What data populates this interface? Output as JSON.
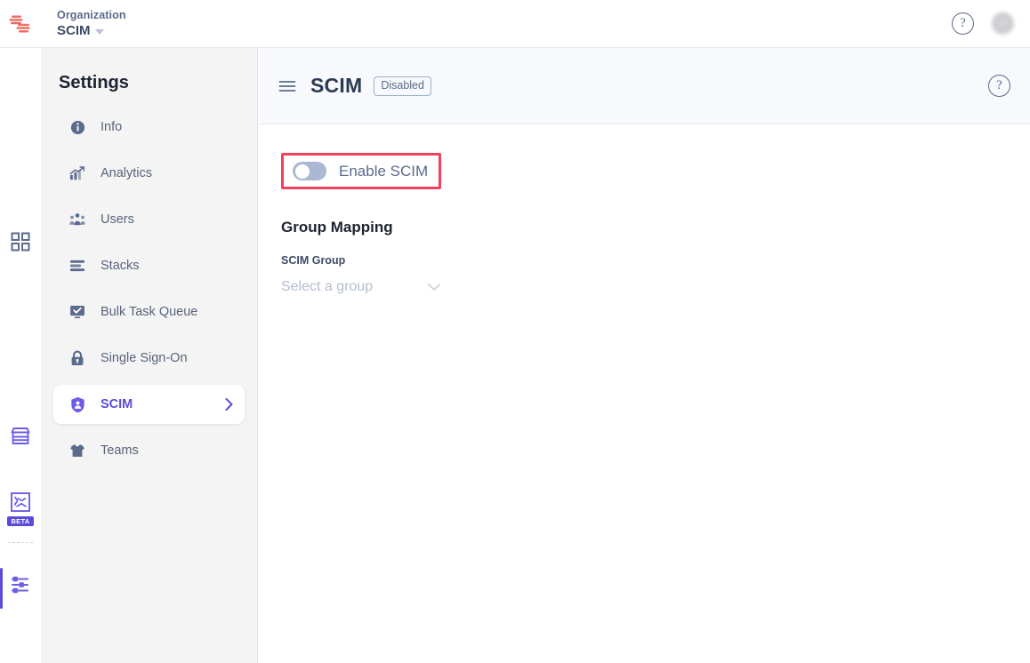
{
  "topbar": {
    "logo_icon": "company-logo",
    "org_label": "Organization",
    "org_name": "SCIM",
    "org_caret_icon": "caret-down-icon",
    "help_icon": "help-circle-icon",
    "help_glyph": "?",
    "avatar_icon": "user-avatar"
  },
  "rail": {
    "items": [
      {
        "icon": "apps-grid-icon",
        "color": "#5b6b8c",
        "badge": null
      },
      {
        "icon": "marketplace-store-icon",
        "color": "#6c5ce7",
        "badge": null
      },
      {
        "icon": "integrations-puzzle-icon",
        "color": "#6c5ce7",
        "badge": "BETA"
      },
      {
        "icon": "settings-sliders-icon",
        "color": "#6c5ce7",
        "badge": null
      }
    ],
    "active_index": 3,
    "active_indicator_color": "#5b4bdb"
  },
  "sidebar": {
    "title": "Settings",
    "items": [
      {
        "label": "Info",
        "icon": "info-circle-icon",
        "active": false
      },
      {
        "label": "Analytics",
        "icon": "analytics-chart-icon",
        "active": false
      },
      {
        "label": "Users",
        "icon": "users-group-icon",
        "active": false
      },
      {
        "label": "Stacks",
        "icon": "stacks-layers-icon",
        "active": false
      },
      {
        "label": "Bulk Task Queue",
        "icon": "bulk-task-check-icon",
        "active": false
      },
      {
        "label": "Single Sign-On",
        "icon": "lock-icon",
        "active": false
      },
      {
        "label": "SCIM",
        "icon": "shield-user-icon",
        "active": true
      },
      {
        "label": "Teams",
        "icon": "teams-shirt-icon",
        "active": false
      }
    ],
    "active_chevron_icon": "chevron-right-icon",
    "active_color": "#5b4bdb"
  },
  "main": {
    "menu_icon": "hamburger-menu-icon",
    "title": "SCIM",
    "status_badge": "Disabled",
    "help_icon": "help-circle-icon",
    "help_glyph": "?",
    "toggle": {
      "label": "Enable SCIM",
      "state": "off",
      "highlight_color": "#f4405c",
      "track_color": "#aab8d4"
    },
    "group_mapping": {
      "section_title": "Group Mapping",
      "field_label": "SCIM Group",
      "select_placeholder": "Select a group",
      "select_value": "",
      "chevron_icon": "chevron-down-icon"
    }
  }
}
